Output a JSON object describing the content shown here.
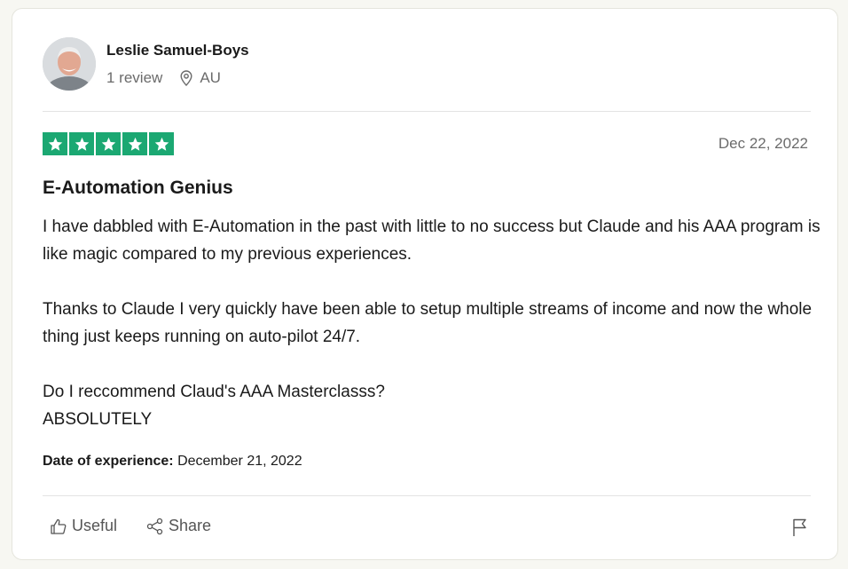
{
  "reviewer": {
    "name": "Leslie Samuel-Boys",
    "review_count": "1 review",
    "country": "AU"
  },
  "rating": {
    "stars": 5,
    "max_stars": 5,
    "color": "#1ba872"
  },
  "review": {
    "date": "Dec 22, 2022",
    "title": "E-Automation Genius",
    "paragraphs": [
      "I have dabbled with E-Automation in the past with little to no success but Claude and his AAA program is like magic compared to my previous experiences.",
      "Thanks to Claude I very quickly have been able to setup multiple streams of income and now the whole thing just keeps running on auto-pilot 24/7.",
      "Do I reccommend Claud's AAA Masterclasss?\nABSOLUTELY"
    ],
    "experience_label": "Date of experience:",
    "experience_date": "December 21, 2022"
  },
  "actions": {
    "useful_label": "Useful",
    "share_label": "Share"
  },
  "icons": {
    "avatar": "avatar",
    "location": "location-pin-icon",
    "star": "star-icon",
    "useful": "thumbs-up-icon",
    "share": "share-icon",
    "flag": "flag-icon"
  }
}
